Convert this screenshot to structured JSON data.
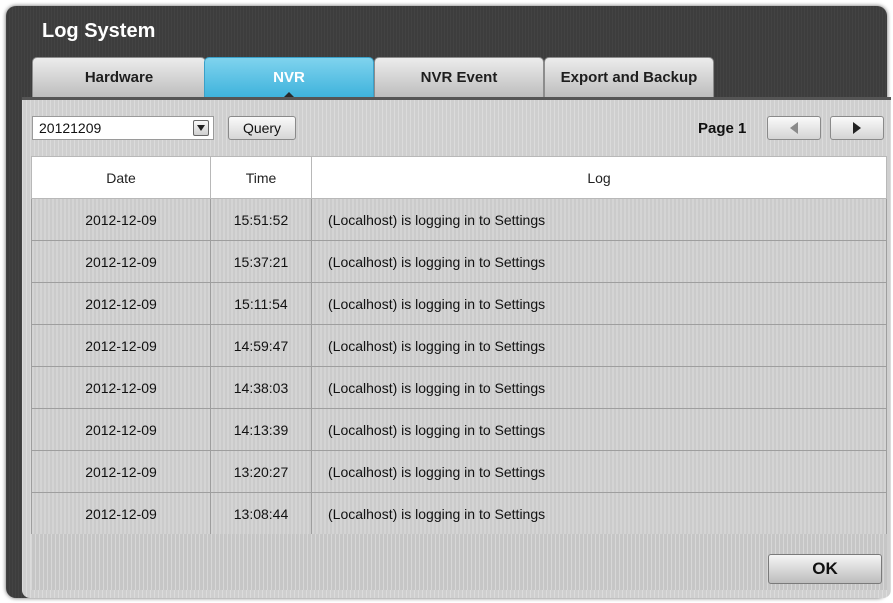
{
  "window": {
    "title": "Log System"
  },
  "tabs": [
    {
      "label": "Hardware",
      "active": false
    },
    {
      "label": "NVR",
      "active": true
    },
    {
      "label": "NVR Event",
      "active": false
    },
    {
      "label": "Export and Backup",
      "active": false
    }
  ],
  "toolbar": {
    "date_value": "20121209",
    "query_label": "Query",
    "page_label": "Page 1",
    "prev_icon": "arrow-left-icon",
    "next_icon": "arrow-right-icon"
  },
  "table": {
    "headers": [
      "Date",
      "Time",
      "Log"
    ],
    "rows": [
      [
        "2012-12-09",
        "15:51:52",
        "(Localhost) is logging in to Settings"
      ],
      [
        "2012-12-09",
        "15:37:21",
        "(Localhost) is logging in to Settings"
      ],
      [
        "2012-12-09",
        "15:11:54",
        "(Localhost) is logging in to Settings"
      ],
      [
        "2012-12-09",
        "14:59:47",
        "(Localhost) is logging in to Settings"
      ],
      [
        "2012-12-09",
        "14:38:03",
        "(Localhost) is logging in to Settings"
      ],
      [
        "2012-12-09",
        "14:13:39",
        "(Localhost) is logging in to Settings"
      ],
      [
        "2012-12-09",
        "13:20:27",
        "(Localhost) is logging in to Settings"
      ],
      [
        "2012-12-09",
        "13:08:44",
        "(Localhost) is logging in to Settings"
      ]
    ]
  },
  "footer": {
    "ok_label": "OK"
  },
  "colors": {
    "active_tab": "#4ab8e0",
    "window_bg": "#3d3d3d",
    "panel_bg": "#cfcfcf"
  }
}
